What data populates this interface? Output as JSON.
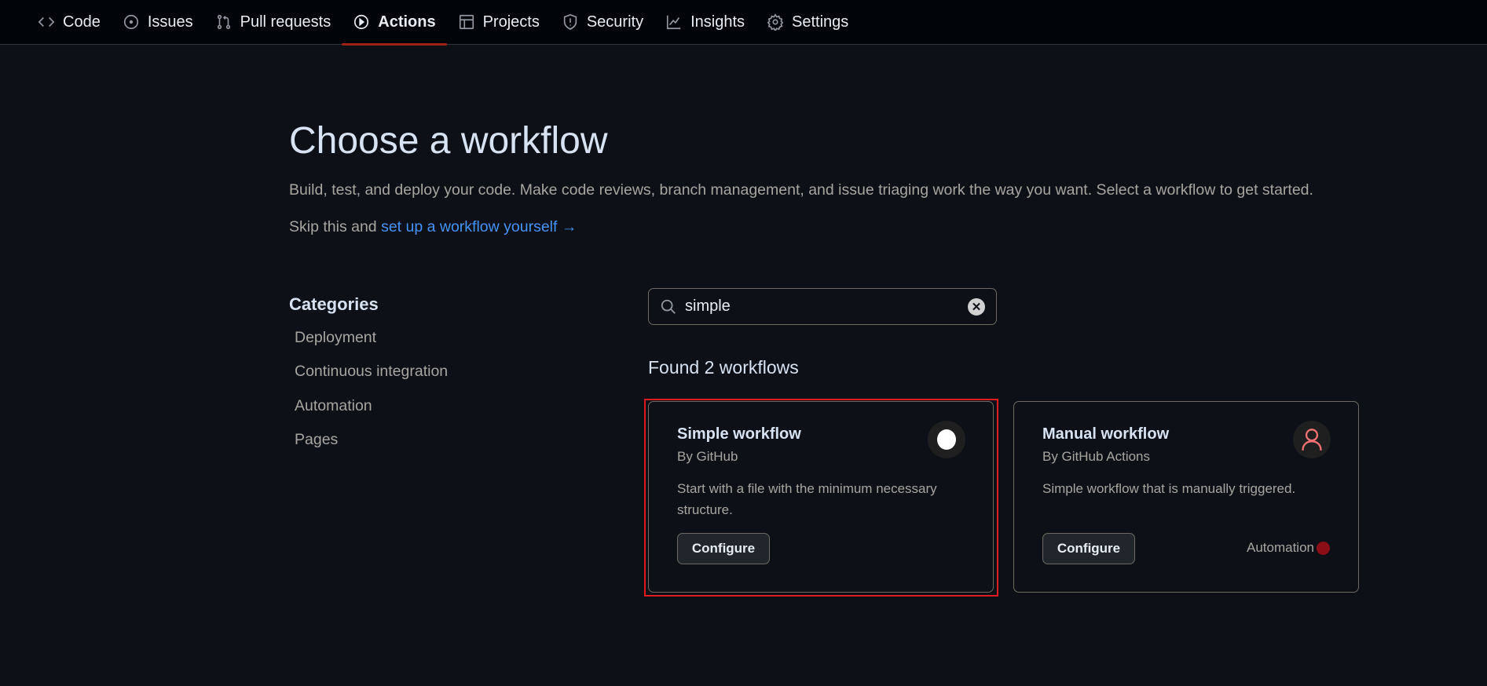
{
  "nav": {
    "tabs": [
      {
        "label": "Code",
        "icon": "code-icon"
      },
      {
        "label": "Issues",
        "icon": "issue-icon"
      },
      {
        "label": "Pull requests",
        "icon": "pull-request-icon"
      },
      {
        "label": "Actions",
        "icon": "play-icon",
        "active": true
      },
      {
        "label": "Projects",
        "icon": "table-icon"
      },
      {
        "label": "Security",
        "icon": "shield-icon"
      },
      {
        "label": "Insights",
        "icon": "graph-icon"
      },
      {
        "label": "Settings",
        "icon": "gear-icon"
      }
    ]
  },
  "page": {
    "title": "Choose a workflow",
    "description": "Build, test, and deploy your code. Make code reviews, branch management, and issue triaging work the way you want. Select a workflow to get started.",
    "skip_prefix": "Skip this and ",
    "skip_link": "set up a workflow yourself →"
  },
  "categories": {
    "heading": "Categories",
    "items": [
      "Deployment",
      "Continuous integration",
      "Automation",
      "Pages"
    ]
  },
  "search": {
    "value": "simple",
    "clear_icon": "x-circle-icon"
  },
  "results": {
    "summary": "Found 2 workflows",
    "workflows": [
      {
        "title": "Simple workflow",
        "by": "By GitHub",
        "description": "Start with a file with the minimum necessary structure.",
        "button": "Configure",
        "icon": "white-circle-icon",
        "selected": true
      },
      {
        "title": "Manual workflow",
        "by": "By GitHub Actions",
        "description": "Simple workflow that is manually triggered.",
        "button": "Configure",
        "icon": "person-icon",
        "category": "Automation",
        "category_color": "#8b0d15"
      }
    ]
  },
  "colors": {
    "accent": "#4493f8",
    "active_underline": "#a02216",
    "selection_outline": "#e01a1f"
  }
}
